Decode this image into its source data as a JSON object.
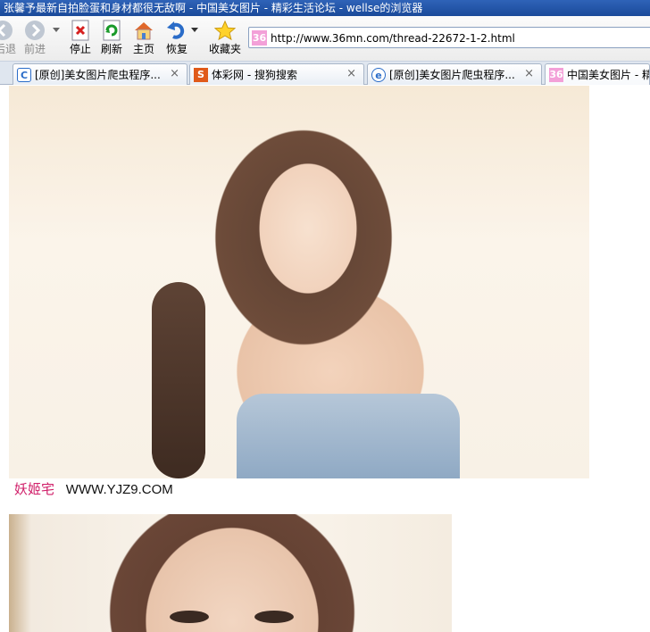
{
  "window": {
    "title": "张馨予最新自拍脸蛋和身材都很无敌啊 - 中国美女图片 - 精彩生活论坛 - wellse的浏览器"
  },
  "toolbar": {
    "back_label": "后退",
    "forward_label": "前进",
    "stop_label": "停止",
    "refresh_label": "刷新",
    "home_label": "主页",
    "restore_label": "恢复",
    "favorites_label": "收藏夹",
    "address_favicon": "36",
    "address_url": "http://www.36mn.com/thread-22672-1-2.html"
  },
  "tabs": [
    {
      "label": "[原创]美女图片爬虫程序...",
      "icon": "C",
      "icon_color": "#2a6cc8",
      "close": "×"
    },
    {
      "label": "体彩网 - 搜狗搜索",
      "icon": "S",
      "icon_color": "#e05a1a",
      "close": "×"
    },
    {
      "label": "[原创]美女图片爬虫程序...",
      "icon": "e",
      "icon_color": "#2a6cc8",
      "close": "×"
    },
    {
      "label": "中国美女图片 - 精",
      "icon": "36",
      "icon_color": "#f3a0d8",
      "close": ""
    }
  ],
  "content": {
    "watermark_brand": "妖姬宅",
    "watermark_site": "WWW.YJZ9.COM"
  }
}
